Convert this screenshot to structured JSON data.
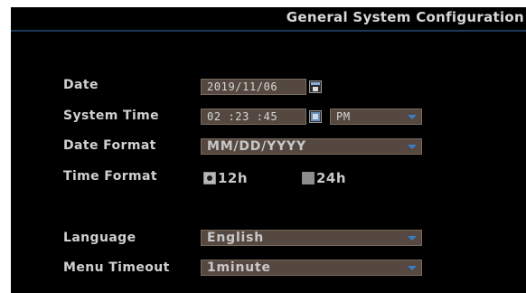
{
  "header": {
    "title": "General System Configuration"
  },
  "date": {
    "label": "Date",
    "value": "2019/11/06",
    "icon": "calendar-icon"
  },
  "system_time": {
    "label": "System Time",
    "value": "02 :23 :45",
    "icon": "time-spin-icon",
    "ampm": "PM"
  },
  "date_format": {
    "label": "Date Format",
    "value": "MM/DD/YYYY"
  },
  "time_format": {
    "label": "Time Format",
    "options": [
      {
        "label": "12h",
        "selected": true
      },
      {
        "label": "24h",
        "selected": false
      }
    ]
  },
  "language": {
    "label": "Language",
    "value": "English"
  },
  "menu_timeout": {
    "label": "Menu Timeout",
    "value": "1minute"
  },
  "colors": {
    "background": "#000000",
    "field_bg": "#554840",
    "field_border": "#7a6a5c",
    "accent_arrow": "#3a7ec8",
    "title_divider": "#1c3a57",
    "text": "#d0d0d0"
  }
}
